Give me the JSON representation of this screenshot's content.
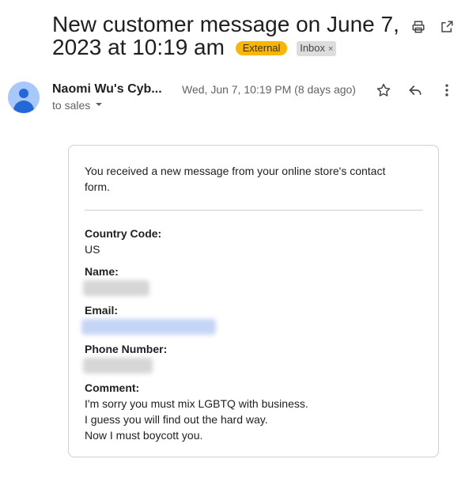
{
  "email": {
    "subject": "New customer message on June 7, 2023 at 10:19 am",
    "labels": {
      "external": "External",
      "inbox": "Inbox",
      "inbox_remove": "×"
    },
    "sender_name": "Naomi Wu's Cyb...",
    "recipient_line": "to sales",
    "date": "Wed, Jun 7, 10:19 PM (8 days ago)"
  },
  "body": {
    "intro": "You received a new message from your online store's contact form.",
    "fields": {
      "country_label": "Country Code:",
      "country_value": "US",
      "name_label": "Name:",
      "email_label": "Email:",
      "phone_label": "Phone Number:",
      "comment_label": "Comment:"
    },
    "comment_lines": [
      "I'm sorry you must mix LGBTQ with business.",
      "I guess you will find out the hard way.",
      "Now I must boycott you."
    ]
  },
  "colors": {
    "external_badge": "#f9b703",
    "inbox_badge": "#dddddd",
    "avatar_bg": "#a8c7fa",
    "avatar_fg": "#0b57d0"
  },
  "icons": [
    "print-icon",
    "open-in-new-window-icon",
    "star-icon",
    "reply-icon",
    "more-vert-icon",
    "chevron-down-icon"
  ]
}
